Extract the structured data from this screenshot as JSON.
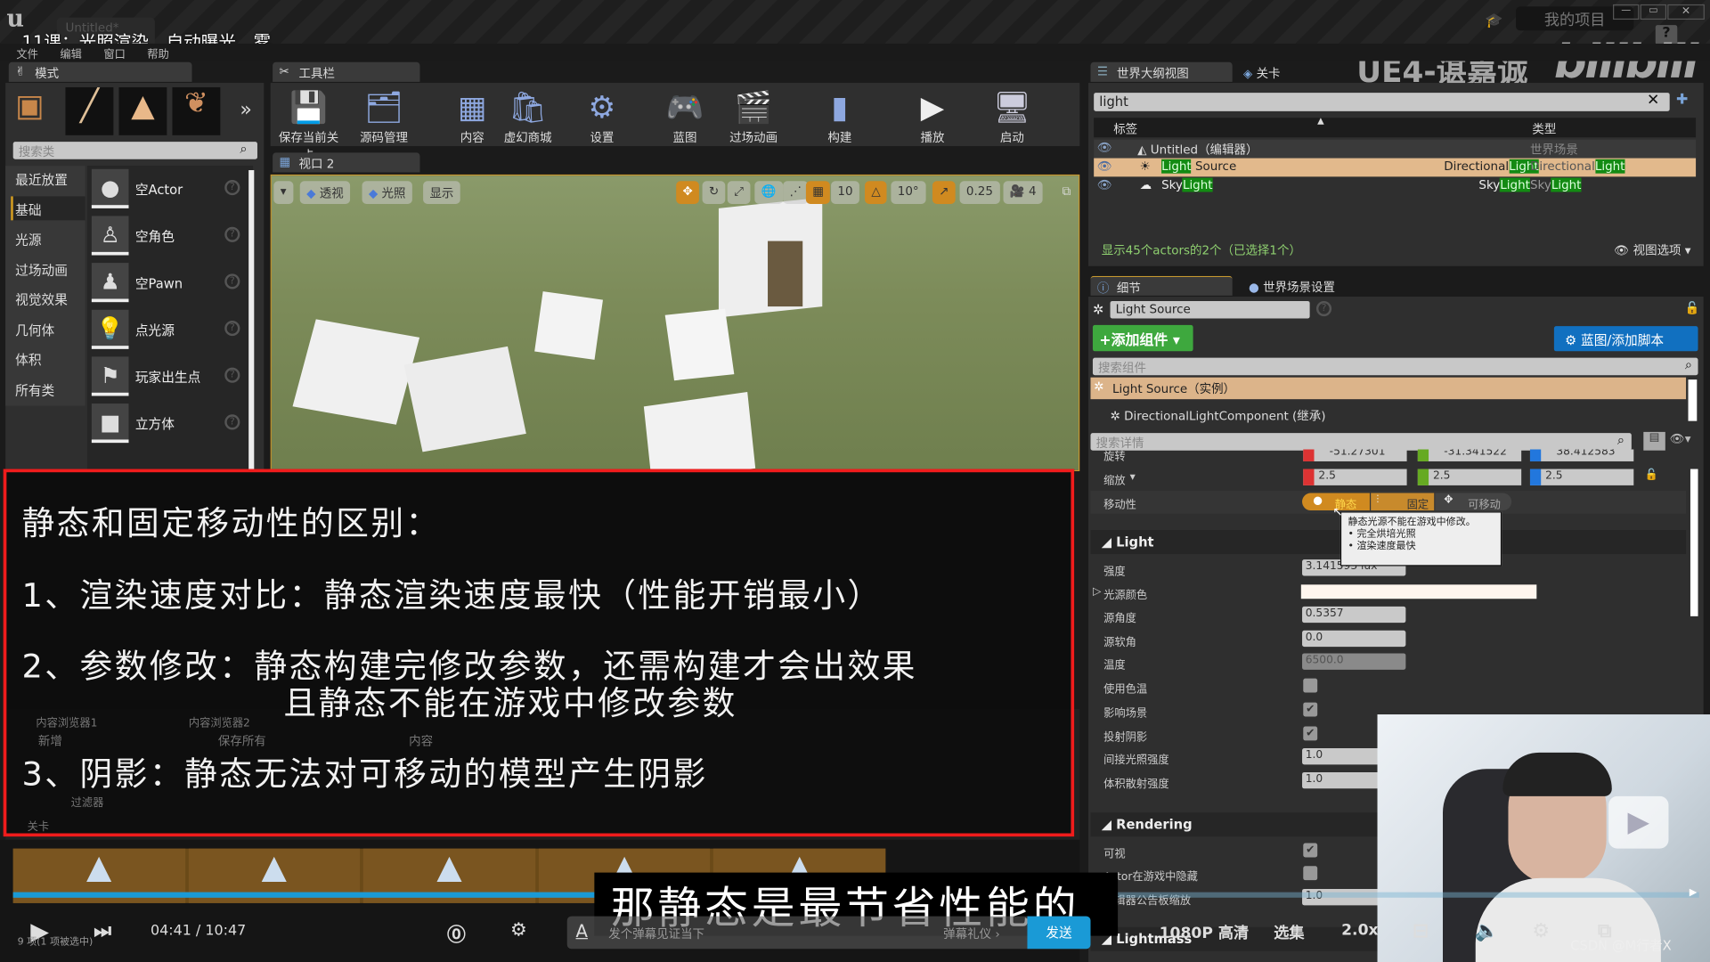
{
  "window": {
    "doc_tab": "Untitled*",
    "course_title": "11课：光照渲染、自动曝光、雾",
    "project": "我的项目",
    "watermark": "UE4-谌嘉诚",
    "brand": "bilibili",
    "min": "—",
    "max": "▭",
    "close": "✕",
    "help": "?"
  },
  "menu": [
    "文件",
    "编辑",
    "窗口",
    "帮助"
  ],
  "modes": {
    "tab": "模式",
    "search_placeholder": "搜索类",
    "categories": [
      "最近放置",
      "基础",
      "光源",
      "过场动画",
      "视觉效果",
      "几何体",
      "体积",
      "所有类"
    ],
    "active_category": "基础",
    "items": [
      {
        "label": "空Actor",
        "icon": "sphere-icon"
      },
      {
        "label": "空角色",
        "icon": "character-icon"
      },
      {
        "label": "空Pawn",
        "icon": "pawn-icon"
      },
      {
        "label": "点光源",
        "icon": "bulb-icon"
      },
      {
        "label": "玩家出生点",
        "icon": "player-start-icon"
      },
      {
        "label": "立方体",
        "icon": "cube-icon"
      }
    ]
  },
  "toolbar": {
    "tab": "工具栏",
    "buttons": [
      {
        "label": "保存当前关卡",
        "icon": "save-icon"
      },
      {
        "label": "源码管理",
        "icon": "source-control-icon"
      },
      {
        "label": "内容",
        "icon": "content-icon"
      },
      {
        "label": "虚幻商城",
        "icon": "marketplace-icon"
      },
      {
        "label": "设置",
        "icon": "settings-icon"
      },
      {
        "label": "蓝图",
        "icon": "blueprint-icon"
      },
      {
        "label": "过场动画",
        "icon": "cinematics-icon"
      },
      {
        "label": "构建",
        "icon": "build-icon"
      },
      {
        "label": "播放",
        "icon": "play-icon"
      },
      {
        "label": "启动",
        "icon": "launch-icon"
      }
    ]
  },
  "viewport": {
    "tab": "视口 2",
    "perspective": "透视",
    "lighting": "光照",
    "show": "显示",
    "grid_snap": "10",
    "rot_snap": "10°",
    "scale_snap": "0.25",
    "cam_speed": "4"
  },
  "overlay": {
    "heading": "静态和固定移动性的区别：",
    "points": [
      "1、渲染速度对比：静态渲染速度最快（性能开销最小）",
      "2、参数修改：静态构建完修改参数，还需构建才会出效果",
      "且静态不能在游戏中修改参数",
      "3、阴影：静态无法对可移动的模型产生阴影"
    ]
  },
  "outliner": {
    "tab": "世界大纲视图",
    "tab2": "关卡",
    "search": "light",
    "col_label": "标签",
    "col_type": "类型",
    "rows": [
      {
        "pre": "",
        "hl": "",
        "post": "Untitled（编辑器）",
        "type_pre": "世界场景",
        "type_hl": ""
      },
      {
        "pre": "",
        "hl": "Light",
        "post": " Source",
        "type_pre": "Directional",
        "type_hl": "Light",
        "type2_pre": "Directional",
        "type2_hl": "Light",
        "selected": true
      },
      {
        "pre": "Sky",
        "hl": "Light",
        "post": "",
        "type_pre": "Sky",
        "type_hl": "Light",
        "type2_pre": "Sky",
        "type2_hl": "Light"
      }
    ],
    "status": "显示45个actors的2个（已选择1个）",
    "view_options": "视图选项"
  },
  "details": {
    "tab": "细节",
    "tab2": "世界场景设置",
    "name": "Light Source",
    "add_component": "+添加组件",
    "blueprint": "蓝图/添加脚本",
    "search_components": "搜索组件",
    "component_root": "Light Source（实例）",
    "component_child": "DirectionalLightComponent (继承)",
    "search_details": "搜索详情",
    "rotation": {
      "label": "旋转",
      "x": "-51.27301",
      "y": "-31.341522",
      "z": "38.412583"
    },
    "scale": {
      "label": "缩放",
      "x": "2.5",
      "y": "2.5",
      "z": "2.5"
    },
    "mobility": {
      "label": "移动性",
      "options": [
        "静态",
        "固定",
        "可移动"
      ],
      "selected": "静态"
    },
    "tooltip": [
      "静态光源不能在游戏中修改。",
      "• 完全烘培光照",
      "• 渲染速度最快"
    ],
    "light_section": "Light",
    "light_props": [
      {
        "k": "强度",
        "v": "3.141593 lux"
      },
      {
        "k": "光源颜色",
        "v": "",
        "color": "#fff6ee"
      },
      {
        "k": "源角度",
        "v": "0.5357"
      },
      {
        "k": "源软角",
        "v": "0.0"
      },
      {
        "k": "温度",
        "v": "6500.0"
      },
      {
        "k": "使用色温",
        "check": false
      },
      {
        "k": "影响场景",
        "check": true
      },
      {
        "k": "投射阴影",
        "check": true
      },
      {
        "k": "间接光照强度",
        "v": "1.0"
      },
      {
        "k": "体积散射强度",
        "v": "1.0"
      }
    ],
    "rendering_section": "Rendering",
    "rendering_props": [
      {
        "k": "可视",
        "check": true
      },
      {
        "k": "Actor在游戏中隐藏",
        "check": false
      },
      {
        "k": "编辑器公告板缩放",
        "v": "1.0"
      }
    ],
    "lightmass_section": "Lightmass"
  },
  "player": {
    "subtitle": "那静态是最节省性能的",
    "time": "04:41 / 10:47",
    "progress": 0.437,
    "danmaku_placeholder": "发个弹幕见证当下",
    "danmaku_etiquette": "弹幕礼仪 ›",
    "send": "发送",
    "quality": "1080P 高清",
    "episodes": "选集",
    "speed": "2.0x",
    "left_status": "9 项(1 项被选中)",
    "credit": "CSDN @M行者X",
    "accent": "#1a9ad6"
  },
  "content_browser": {
    "tab1": "内容浏览器1",
    "tab2": "内容浏览器2",
    "new": "新增",
    "save_all": "保存所有",
    "content": "内容",
    "filter": "过滤器",
    "level": "关卡"
  }
}
